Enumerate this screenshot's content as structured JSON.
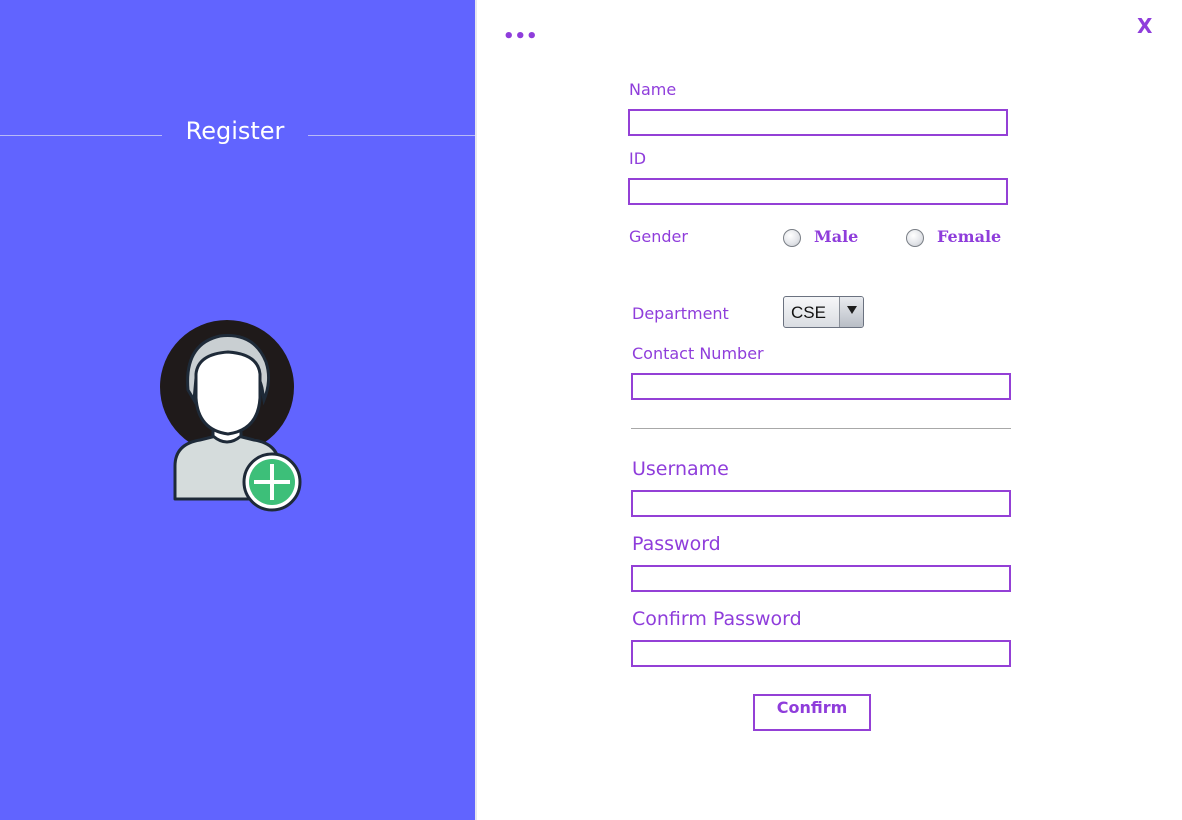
{
  "window": {
    "more_label": "•••",
    "close_label": "X"
  },
  "sidebar": {
    "title": "Register",
    "avatar_icon": "add-user-icon"
  },
  "form": {
    "name": {
      "label": "Name",
      "value": ""
    },
    "id": {
      "label": "ID",
      "value": ""
    },
    "gender": {
      "label": "Gender",
      "options": [
        "Male",
        "Female"
      ],
      "selected": null
    },
    "department": {
      "label": "Department",
      "selected": "CSE"
    },
    "contact": {
      "label": "Contact Number",
      "value": ""
    },
    "username": {
      "label": "Username",
      "value": ""
    },
    "password": {
      "label": "Password",
      "value": ""
    },
    "confirm_password": {
      "label": "Confirm Password",
      "value": ""
    },
    "confirm_button": "Confirm"
  },
  "colors": {
    "sidebar_bg": "#6164ff",
    "accent": "#8f3ddb",
    "field_border": "#9440d6",
    "plus_badge": "#3dbf79"
  }
}
